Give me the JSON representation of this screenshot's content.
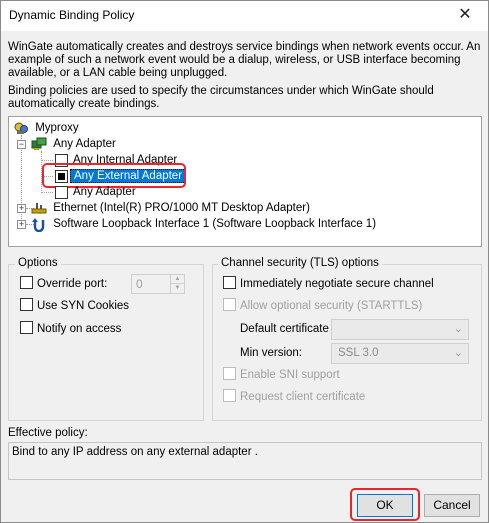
{
  "window": {
    "title": "Dynamic Binding Policy",
    "close_glyph": "✕"
  },
  "intro": {
    "paragraph1": "WinGate automatically creates and destroys service bindings when network events occur. An example of such a network event would be a dialup, wireless, or USB interface becoming available, or a LAN cable being unplugged.",
    "paragraph2": "Binding policies are used to specify the circumstances under which WinGate should automatically create bindings."
  },
  "tree": {
    "root": {
      "label": "Myproxy",
      "icon": "computer-icon"
    },
    "any_adapter_group": {
      "label": "Any Adapter",
      "icon": "network-adapters-icon",
      "expander": "−"
    },
    "items": [
      {
        "label": "Any Internal Adapter",
        "checked": false
      },
      {
        "label": "Any External Adapter",
        "checked": true,
        "selected": true
      },
      {
        "label": "Any Adapter",
        "checked": false
      }
    ],
    "ethernet": {
      "label": "Ethernet (Intel(R) PRO/1000 MT Desktop Adapter)",
      "icon": "ethernet-icon",
      "expander": "+"
    },
    "loopback": {
      "label": "Software Loopback Interface 1 (Software Loopback Interface 1)",
      "icon": "loopback-icon",
      "expander": "+"
    }
  },
  "options": {
    "title": "Options",
    "override_port_label": "Override port:",
    "override_port_value": "0",
    "use_syn_cookies_label": "Use SYN Cookies",
    "notify_on_access_label": "Notify on access"
  },
  "tls": {
    "title": "Channel security (TLS) options",
    "immediately_negotiate_label": "Immediately negotiate secure channel",
    "allow_optional_label": "Allow optional security (STARTTLS)",
    "default_certificate_label": "Default certificate",
    "default_certificate_value": "",
    "min_version_label": "Min version:",
    "min_version_value": "SSL 3.0",
    "enable_sni_label": "Enable SNI support",
    "request_client_cert_label": "Request client certificate"
  },
  "effective_policy": {
    "label": "Effective policy:",
    "text": "Bind to any IP address on any external adapter ."
  },
  "buttons": {
    "ok": "OK",
    "cancel": "Cancel"
  },
  "colors": {
    "selection": "#0078d7",
    "highlight_ring": "#e8262b"
  }
}
